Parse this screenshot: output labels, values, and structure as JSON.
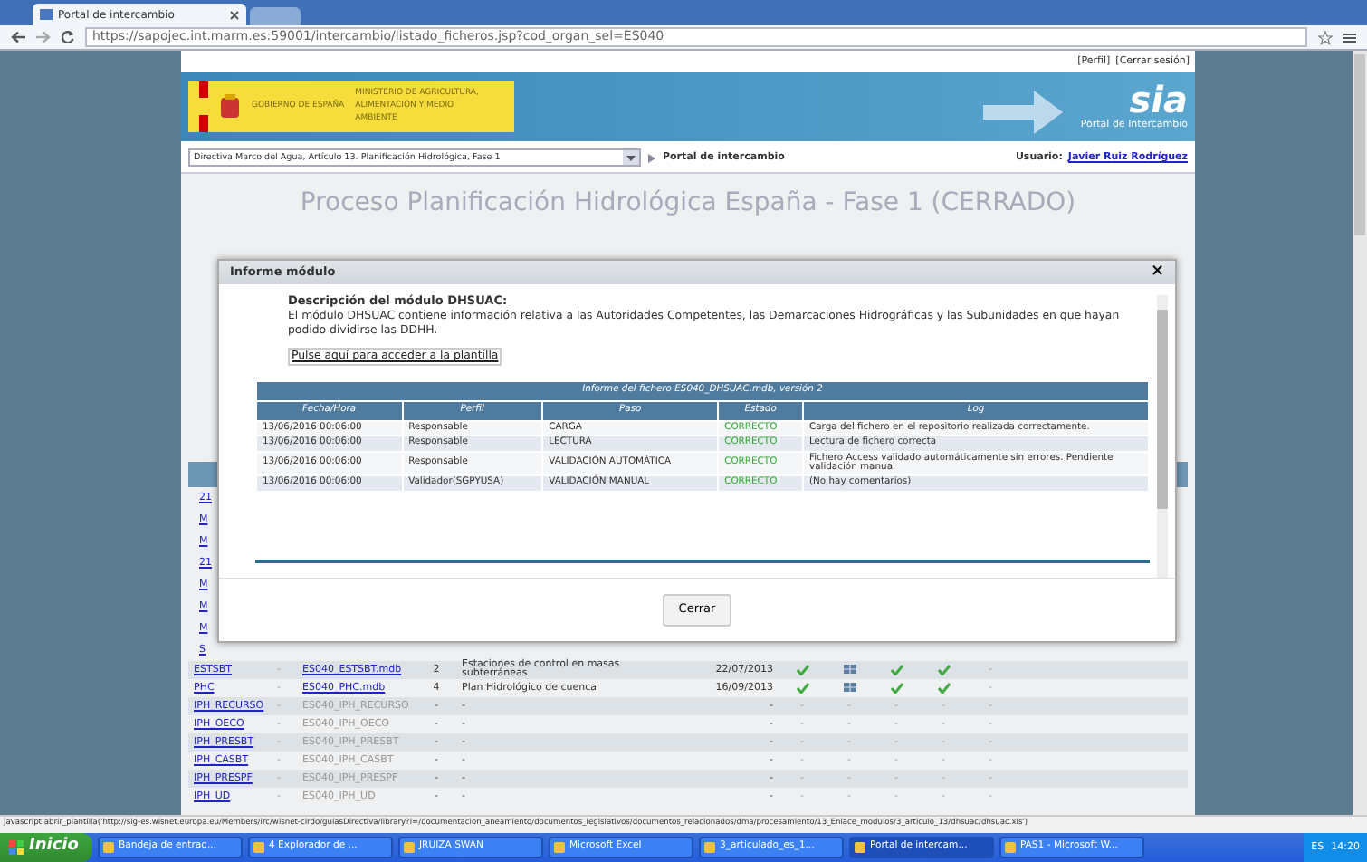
{
  "browser": {
    "tab_title": "Portal de intercambio",
    "url": "https://sapojec.int.marm.es:59001/intercambio/listado_ficheros.jsp?cod_organ_sel=ES040"
  },
  "header": {
    "links": [
      "[Perfil]",
      "[Cerrar sesión]"
    ],
    "gov": "GOBIERNO DE ESPAÑA",
    "ministry": "MINISTERIO DE AGRICULTURA, ALIMENTACIÓN Y MEDIO AMBIENTE",
    "logo": "sia",
    "logo_caption": "Portal de Intercambio"
  },
  "toolbar": {
    "select_value": "Directiva Marco del Agua, Artículo 13. Planificación Hidrológica, Fase 1",
    "breadcrumb": "Portal de intercambio",
    "user_label": "Usuario:",
    "user": "Javier Ruiz Rodríguez"
  },
  "page_title": "Proceso Planificación Hidrológica España - Fase 1 (CERRADO)",
  "background_links": [
    "21",
    "M",
    "M",
    "21",
    "M",
    "M",
    "M",
    "S"
  ],
  "rows": [
    {
      "code": "ESTSBT",
      "sep": "-",
      "file": "ES040_ESTSBT.mdb",
      "file_link": true,
      "version": "2",
      "description": "Estaciones de control en masas subterráneas",
      "date": "22/07/2013",
      "status": [
        {
          "kind": "check"
        },
        {
          "kind": "grid"
        },
        {
          "kind": "check"
        },
        {
          "kind": "check"
        },
        {
          "kind": "dash",
          "text": "-"
        }
      ]
    },
    {
      "code": "PHC",
      "sep": "-",
      "file": "ES040_PHC.mdb",
      "file_link": true,
      "version": "4",
      "description": "Plan Hidrológico de cuenca",
      "date": "16/09/2013",
      "status": [
        {
          "kind": "check"
        },
        {
          "kind": "grid"
        },
        {
          "kind": "check"
        },
        {
          "kind": "check"
        },
        {
          "kind": "dash",
          "text": "-"
        }
      ]
    },
    {
      "code": "IPH_RECURSO",
      "sep": "-",
      "file": "ES040_IPH_RECURSO",
      "file_link": false,
      "version": "-",
      "description": "-",
      "date": "-",
      "status": [
        {
          "kind": "dash",
          "text": "-"
        },
        {
          "kind": "dash",
          "text": "-"
        },
        {
          "kind": "dash",
          "text": "-"
        },
        {
          "kind": "dash",
          "text": "-"
        },
        {
          "kind": "dash",
          "text": "-"
        }
      ]
    },
    {
      "code": "IPH_OECO",
      "sep": "-",
      "file": "ES040_IPH_OECO",
      "file_link": false,
      "version": "-",
      "description": "-",
      "date": "-",
      "status": [
        {
          "kind": "dash",
          "text": "-"
        },
        {
          "kind": "dash",
          "text": "-"
        },
        {
          "kind": "dash",
          "text": "-"
        },
        {
          "kind": "dash",
          "text": "-"
        },
        {
          "kind": "dash",
          "text": "-"
        }
      ]
    },
    {
      "code": "IPH_PRESBT",
      "sep": "-",
      "file": "ES040_IPH_PRESBT",
      "file_link": false,
      "version": "-",
      "description": "-",
      "date": "-",
      "status": [
        {
          "kind": "dash",
          "text": "-"
        },
        {
          "kind": "dash",
          "text": "-"
        },
        {
          "kind": "dash",
          "text": "-"
        },
        {
          "kind": "dash",
          "text": "-"
        },
        {
          "kind": "dash",
          "text": "-"
        }
      ]
    },
    {
      "code": "IPH_CASBT",
      "sep": "-",
      "file": "ES040_IPH_CASBT",
      "file_link": false,
      "version": "-",
      "description": "-",
      "date": "-",
      "status": [
        {
          "kind": "dash",
          "text": "-"
        },
        {
          "kind": "dash",
          "text": "-"
        },
        {
          "kind": "dash",
          "text": "-"
        },
        {
          "kind": "dash",
          "text": "-"
        },
        {
          "kind": "dash",
          "text": "-"
        }
      ]
    },
    {
      "code": "IPH_PRESPF",
      "sep": "-",
      "file": "ES040_IPH_PRESPF",
      "file_link": false,
      "version": "-",
      "description": "-",
      "date": "-",
      "status": [
        {
          "kind": "dash",
          "text": "-"
        },
        {
          "kind": "dash",
          "text": "-"
        },
        {
          "kind": "dash",
          "text": "-"
        },
        {
          "kind": "dash",
          "text": "-"
        },
        {
          "kind": "dash",
          "text": "-"
        }
      ]
    },
    {
      "code": "IPH_UD",
      "sep": "-",
      "file": "ES040_IPH_UD",
      "file_link": false,
      "version": "-",
      "description": "-",
      "date": "-",
      "status": [
        {
          "kind": "dash",
          "text": "-"
        },
        {
          "kind": "dash",
          "text": "-"
        },
        {
          "kind": "dash",
          "text": "-"
        },
        {
          "kind": "dash",
          "text": "-"
        },
        {
          "kind": "dash",
          "text": "-"
        }
      ]
    }
  ],
  "modal": {
    "title": "Informe módulo",
    "close": "×",
    "heading": "Descripción del módulo DHSUAC:",
    "text": "El módulo DHSUAC contiene información relativa a las Autoridades Competentes, las Demarcaciones Hidrográficas y las Subunidades en que hayan podido dividirse las DDHH.",
    "template_link": "Pulse aquí para acceder a la plantilla",
    "table_caption": "Informe del fichero ES040_DHSUAC.mdb, versión 2",
    "columns": [
      "Fecha/Hora",
      "Perfil",
      "Paso",
      "Estado",
      "Log"
    ],
    "rows": [
      [
        "13/06/2016 00:06:00",
        "Responsable",
        "CARGA",
        "CORRECTO",
        "Carga del fichero en el repositorio realizada correctamente."
      ],
      [
        "13/06/2016 00:06:00",
        "Responsable",
        "LECTURA",
        "CORRECTO",
        "Lectura de fichero correcta"
      ],
      [
        "13/06/2016 00:06:00",
        "Responsable",
        "VALIDACIÓN AUTOMÁTICA",
        "CORRECTO",
        "Fichero Access validado automáticamente sin errores. Pendiente validación manual"
      ],
      [
        "13/06/2016 00:06:00",
        "Validador(SGPYUSA)",
        "VALIDACIÓN MANUAL",
        "CORRECTO",
        "(No hay comentarios)"
      ]
    ],
    "button": "Cerrar"
  },
  "status_url": "javascript:abrir_plantilla('http://sig-es.wisnet.europa.eu/Members/irc/wisnet-cirdo/guiasDirectiva/library?l=/documentacion_aneamiento/documentos_legislativos/documentos_relacionados/dma/procesamiento/13_Enlace_modulos/3_articulo_13/dhsuac/dhsuac.xls')",
  "taskbar": {
    "start": "Inicio",
    "items": [
      "Bandeja de entrad...",
      "4 Explorador de ...",
      "JRUIZA SWAN",
      "Microsoft Excel",
      "3_articulado_es_1...",
      "Portal de intercam...",
      "PAS1 - Microsoft W..."
    ],
    "lang": "ES",
    "clock": "14:20"
  }
}
